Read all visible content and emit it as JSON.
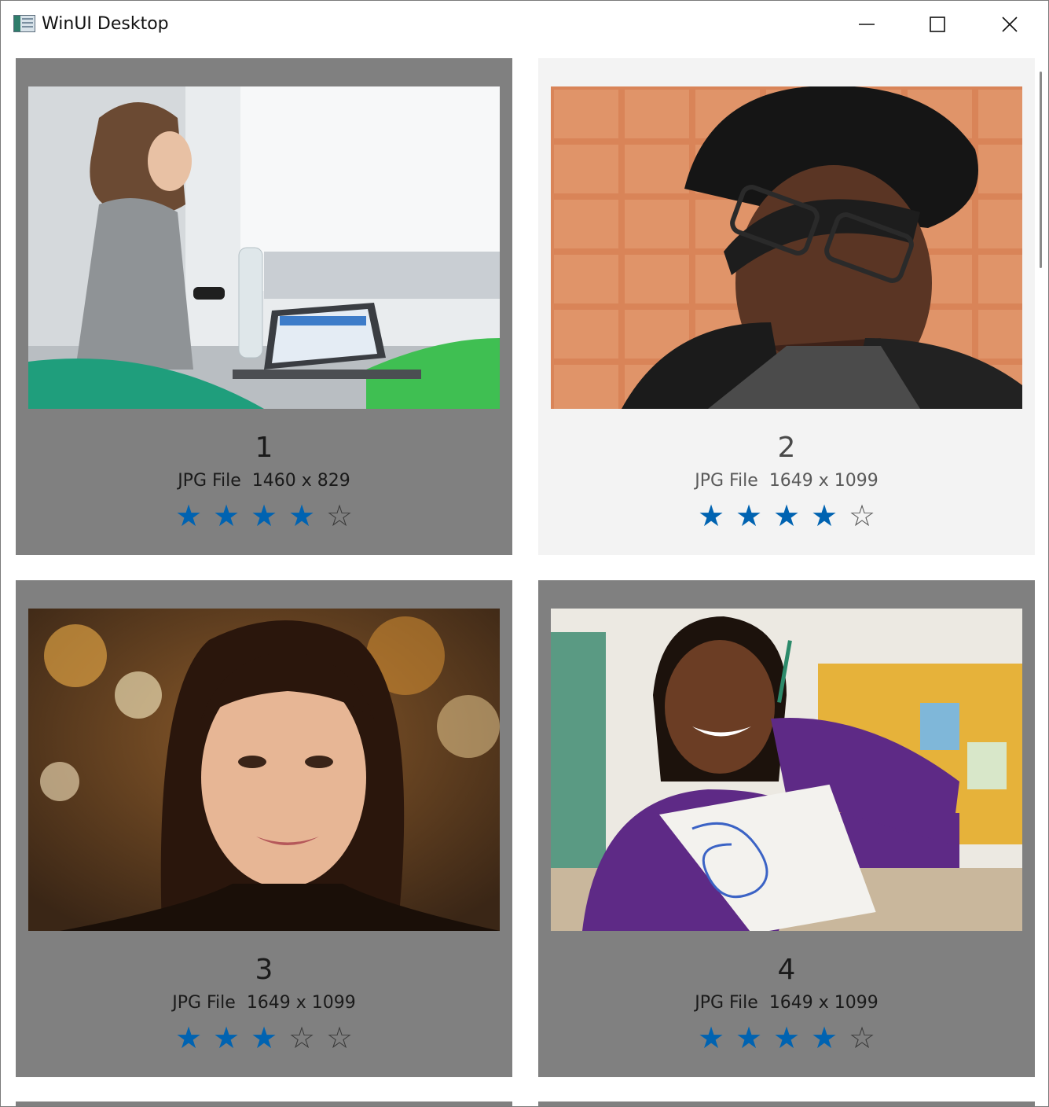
{
  "window": {
    "title": "WinUI Desktop"
  },
  "items": [
    {
      "number": "1",
      "file_type": "JPG File",
      "dimensions": "1460 x 829",
      "rating": 4,
      "max_rating": 5,
      "image": "woman-with-water-bottle-and-laptop-photo",
      "selected": false
    },
    {
      "number": "2",
      "file_type": "JPG File",
      "dimensions": "1649 x 1099",
      "rating": 4,
      "max_rating": 5,
      "image": "young-man-with-glasses-photo",
      "selected": true
    },
    {
      "number": "3",
      "file_type": "JPG File",
      "dimensions": "1649 x 1099",
      "rating": 3,
      "max_rating": 5,
      "image": "woman-with-bangs-portrait-photo",
      "selected": false
    },
    {
      "number": "4",
      "file_type": "JPG File",
      "dimensions": "1649 x 1099",
      "rating": 4,
      "max_rating": 5,
      "image": "girl-holding-maze-drawing-photo",
      "selected": false
    }
  ],
  "colors": {
    "card_background": "#808080",
    "selected_card_background": "#f3f3f3",
    "star_filled": "#0063b1"
  }
}
